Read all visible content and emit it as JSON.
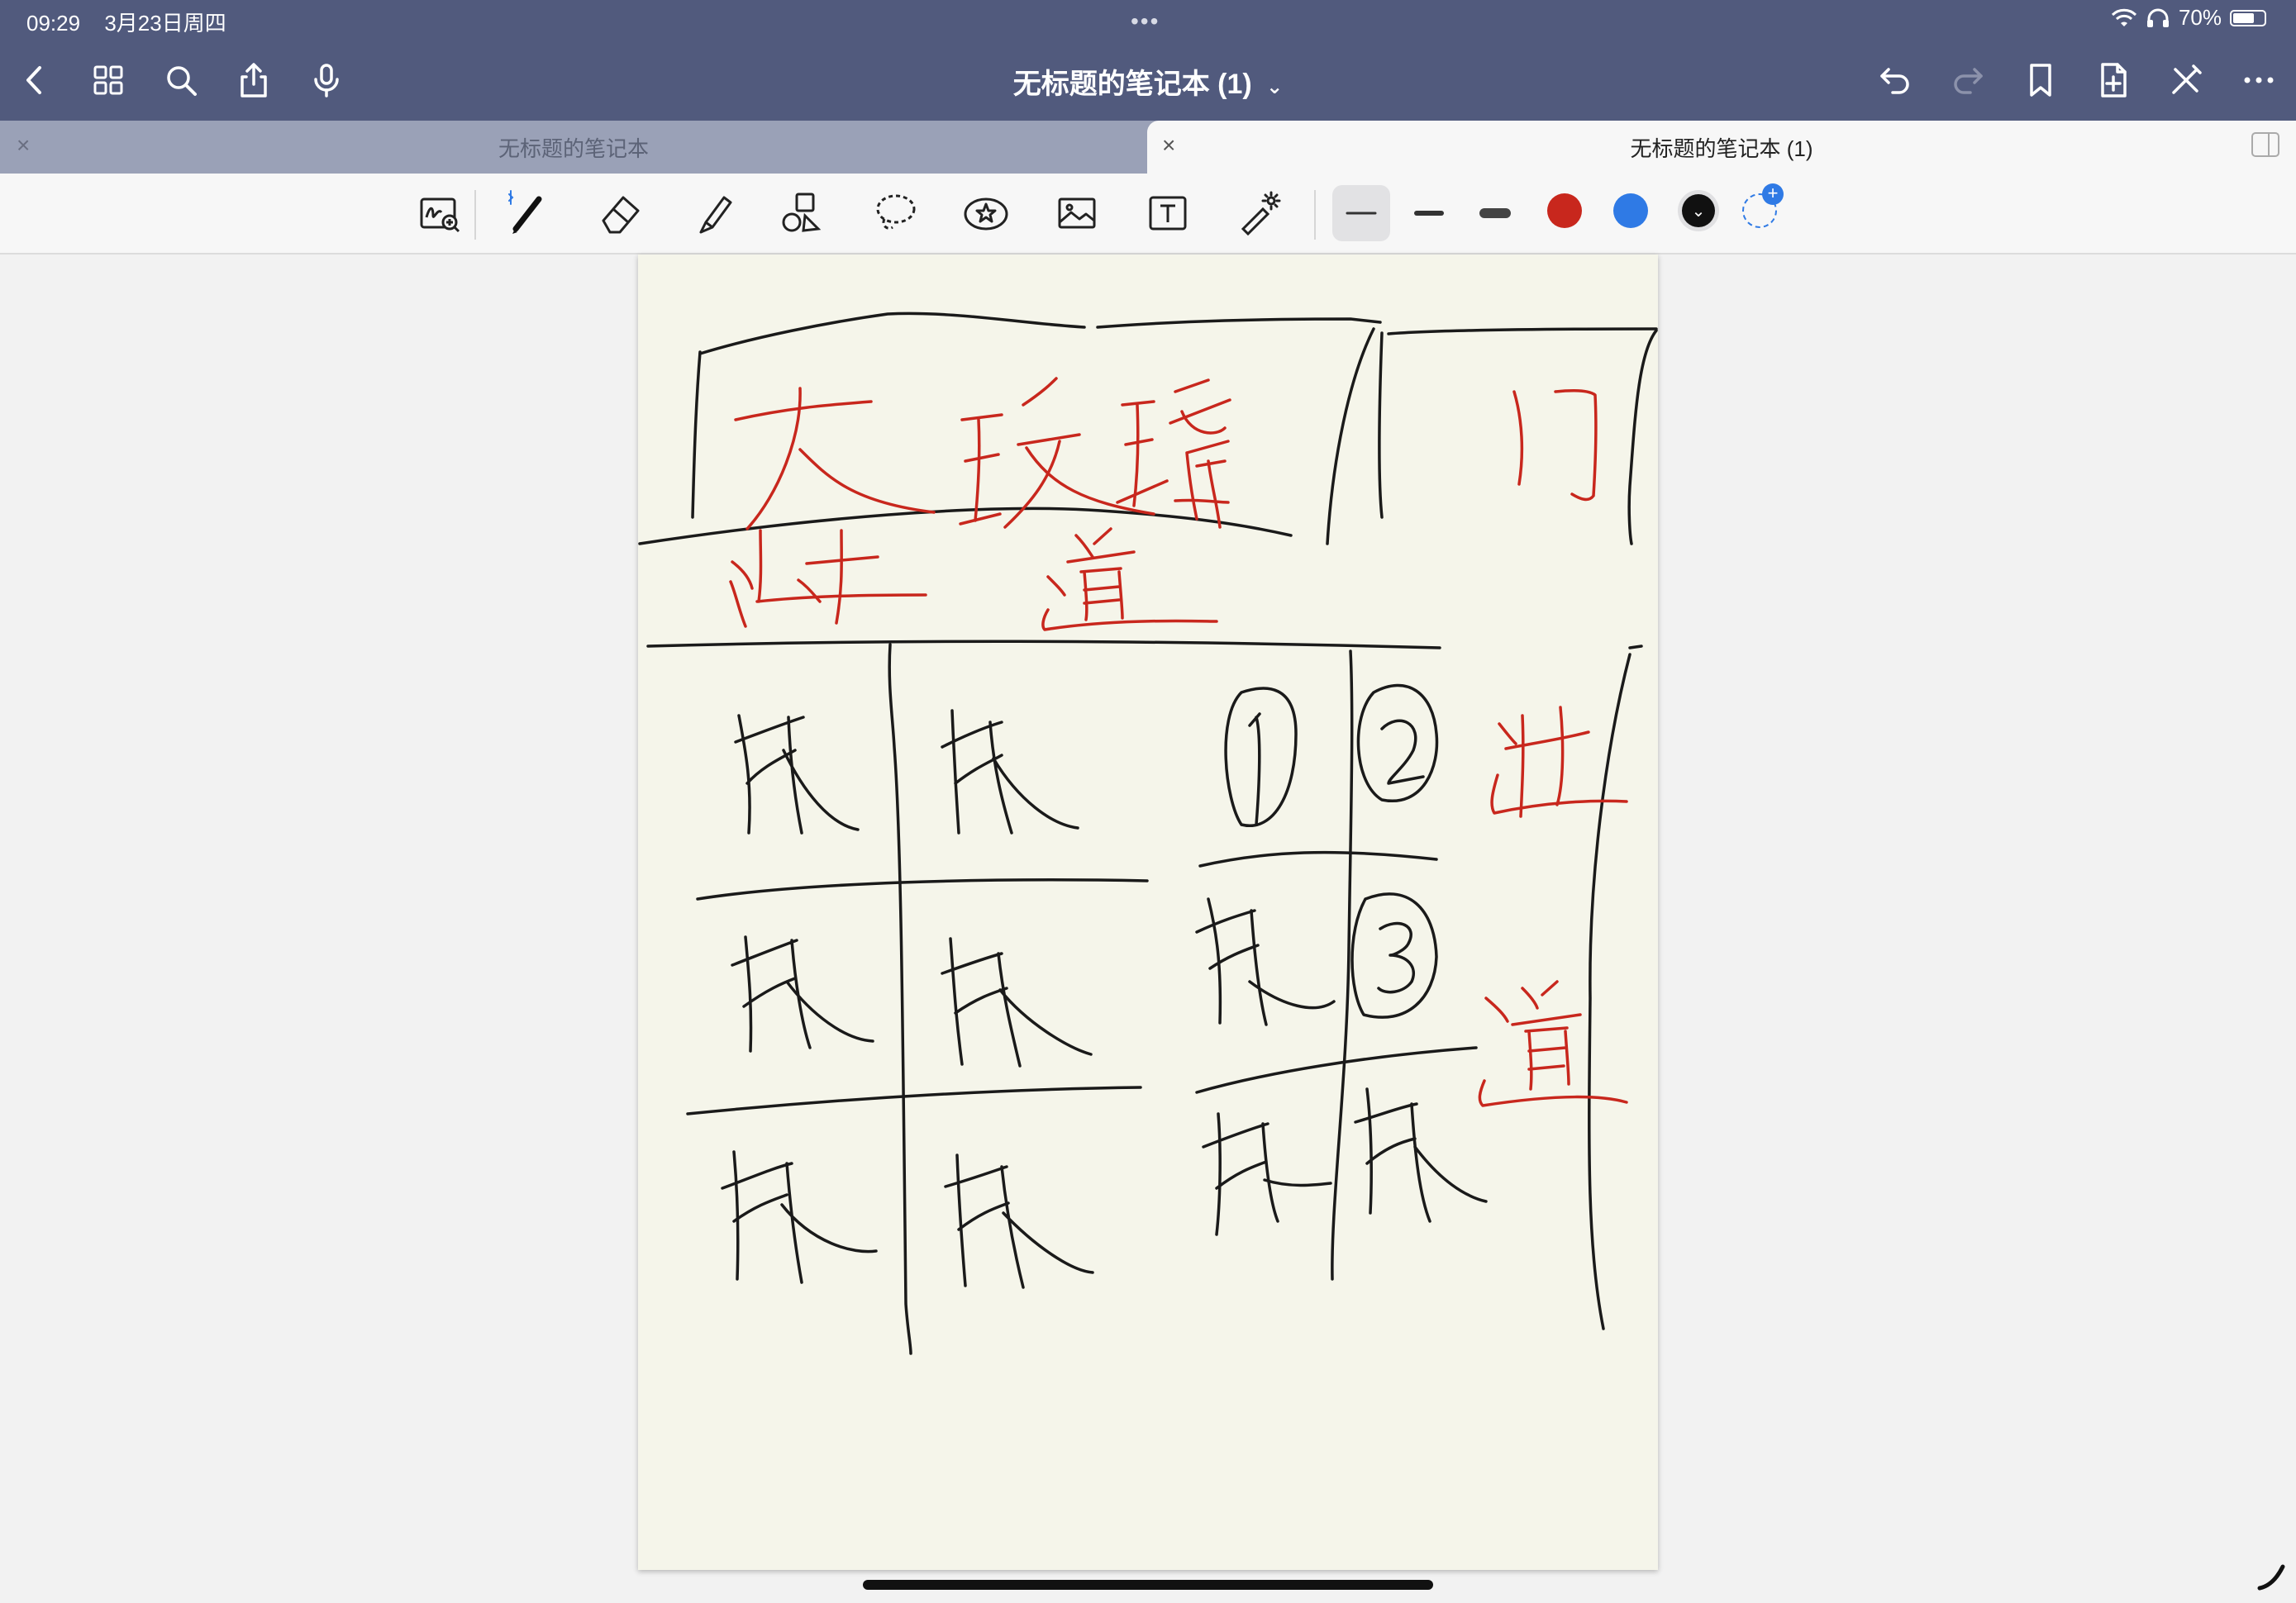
{
  "status": {
    "time": "09:29",
    "date": "3月23日周四",
    "battery": "70%",
    "battery_level": 0.7
  },
  "header": {
    "title": "无标题的笔记本 (1)"
  },
  "tabs": [
    {
      "label": "无标题的笔记本",
      "active": false
    },
    {
      "label": "无标题的笔记本 (1)",
      "active": true
    }
  ],
  "toolbar": {
    "tools": [
      "zoom-window-tool",
      "pen-tool",
      "eraser-tool",
      "highlighter-tool",
      "shapes-tool",
      "lasso-tool",
      "sticker-tool",
      "image-tool",
      "text-tool",
      "laser-pointer-tool"
    ],
    "selected_tool": "pen-tool",
    "stroke_sizes": [
      "thin",
      "medium",
      "thick"
    ],
    "selected_stroke": "thin",
    "colors": [
      "#c8271d",
      "#2f7ae5",
      "#111111"
    ],
    "selected_color": "#111111"
  },
  "note": {
    "ink_black": "#1a1a1a",
    "ink_red": "#c8271d",
    "paper": "#f5f5ea",
    "handwriting": [
      {
        "text": "大玻璃",
        "color": "red"
      },
      {
        "text": "门",
        "color": "red"
      },
      {
        "text": "过",
        "color": "red"
      },
      {
        "text": "道",
        "color": "red"
      },
      {
        "text": "过",
        "color": "red"
      },
      {
        "text": "道",
        "color": "red"
      },
      {
        "text": "有人",
        "color": "black"
      },
      {
        "text": "有人",
        "color": "black"
      },
      {
        "text": "①",
        "color": "black"
      },
      {
        "text": "②",
        "color": "black"
      },
      {
        "text": "有人",
        "color": "black"
      },
      {
        "text": "有人",
        "color": "black"
      },
      {
        "text": "有人",
        "color": "black"
      },
      {
        "text": "③",
        "color": "black"
      },
      {
        "text": "有人",
        "color": "black"
      },
      {
        "text": "有人",
        "color": "black"
      },
      {
        "text": "有人",
        "color": "black"
      },
      {
        "text": "有人",
        "color": "black"
      }
    ]
  }
}
